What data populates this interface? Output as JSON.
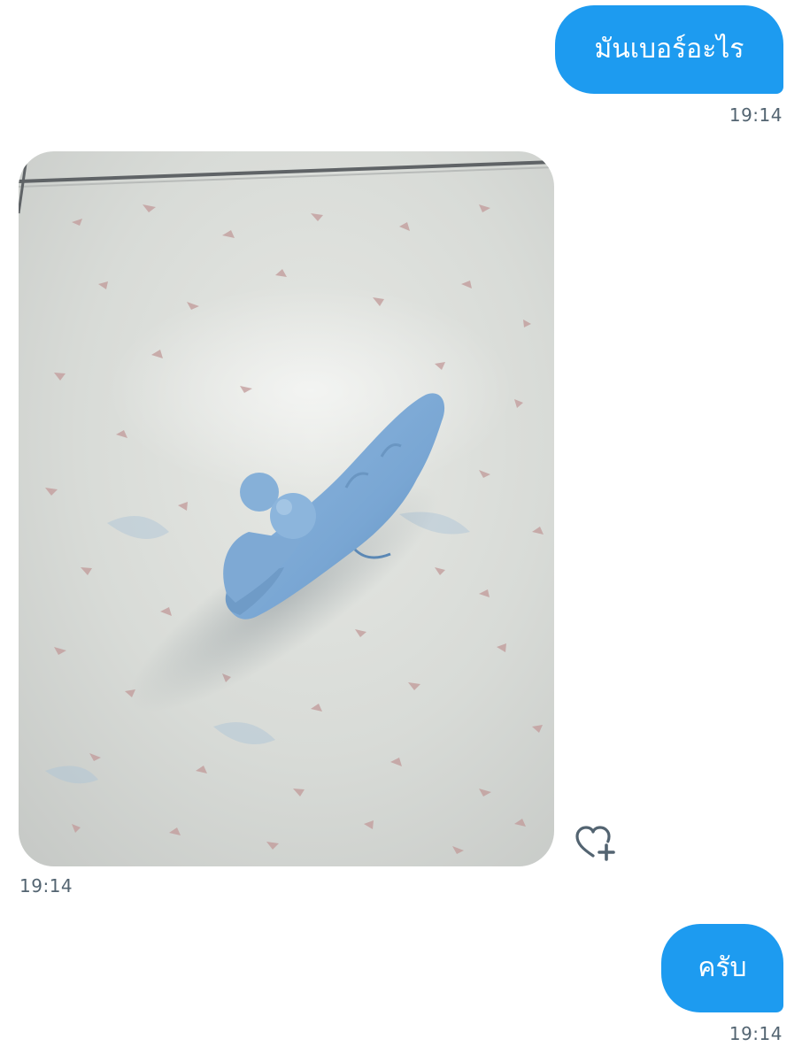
{
  "messages": [
    {
      "id": "m1",
      "direction": "outgoing",
      "type": "text",
      "text": "มันเบอร์อะไร",
      "time": "19:14"
    },
    {
      "id": "m2",
      "direction": "incoming",
      "type": "photo",
      "photo_alt": "",
      "time": "19:14",
      "reaction_icon": "heart-plus-icon"
    },
    {
      "id": "m3",
      "direction": "outgoing",
      "type": "text",
      "text": "ครับ",
      "time": "19:14"
    }
  ],
  "colors": {
    "bubble_out": "#1d9bf0",
    "bubble_out_text": "#ffffff",
    "timestamp": "#536471",
    "icon": "#536471",
    "background": "#ffffff"
  }
}
